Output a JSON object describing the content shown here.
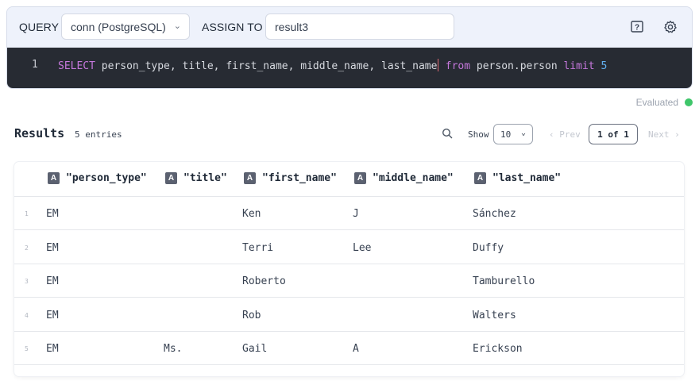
{
  "toolbar": {
    "query_label": "QUERY",
    "connection_value": "conn (PostgreSQL)",
    "assign_label": "ASSIGN TO",
    "assign_value": "result3"
  },
  "editor": {
    "line_number": "1",
    "sql_before_cursor": "SELECT person_type, title, first_name, middle_name, last_name",
    "sql_after_cursor": " from person.person limit 5"
  },
  "status": {
    "text": "Evaluated",
    "color": "#3fc66a"
  },
  "results": {
    "title": "Results",
    "count_text": "5 entries",
    "show_label": "Show",
    "page_size": "10",
    "prev_label": "‹ Prev",
    "page_indicator": "1 of 1",
    "next_label": "Next ›"
  },
  "table": {
    "columns": [
      "\"person_type\"",
      "\"title\"",
      "\"first_name\"",
      "\"middle_name\"",
      "\"last_name\""
    ],
    "column_type": "A",
    "rows": [
      {
        "index": "1",
        "person_type": "EM",
        "title": "",
        "first_name": "Ken",
        "middle_name": "J",
        "last_name": "Sánchez"
      },
      {
        "index": "2",
        "person_type": "EM",
        "title": "",
        "first_name": "Terri",
        "middle_name": "Lee",
        "last_name": "Duffy"
      },
      {
        "index": "3",
        "person_type": "EM",
        "title": "",
        "first_name": "Roberto",
        "middle_name": "",
        "last_name": "Tamburello"
      },
      {
        "index": "4",
        "person_type": "EM",
        "title": "",
        "first_name": "Rob",
        "middle_name": "",
        "last_name": "Walters"
      },
      {
        "index": "5",
        "person_type": "EM",
        "title": "Ms.",
        "first_name": "Gail",
        "middle_name": "A",
        "last_name": "Erickson"
      }
    ]
  },
  "icons": {
    "help": "help-icon",
    "settings": "gear-icon",
    "search": "search-icon"
  }
}
